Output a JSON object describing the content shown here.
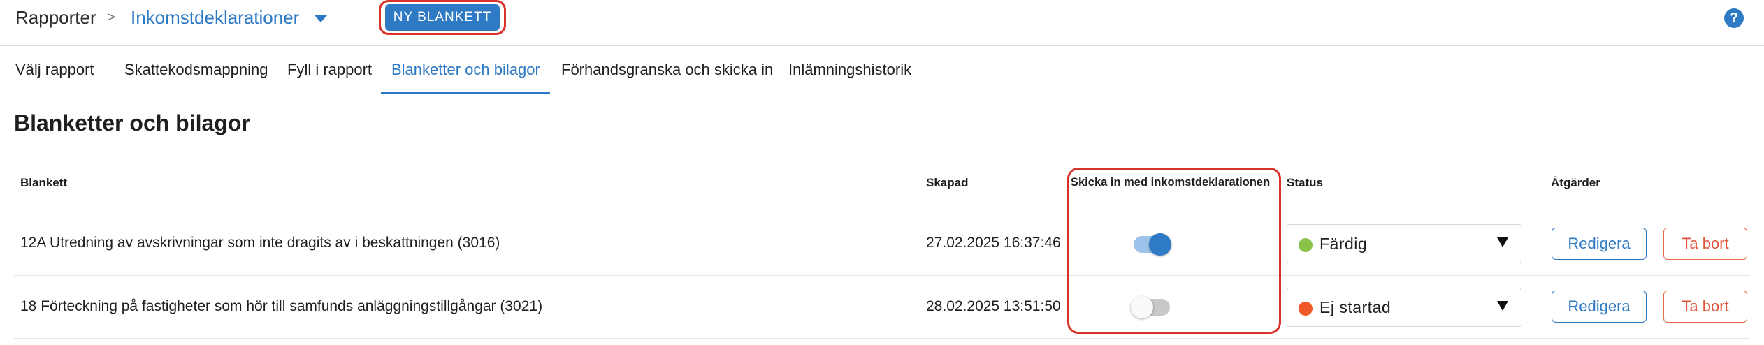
{
  "breadcrumb": {
    "root": "Rapporter",
    "separator": ">",
    "current": "Inkomstdeklarationer"
  },
  "header": {
    "new_button_label": "NY BLANKETT",
    "help_label": "?"
  },
  "tabs": [
    {
      "label": "Välj rapport",
      "active": false
    },
    {
      "label": "Skattekodsmappning",
      "active": false
    },
    {
      "label": "Fyll i rapport",
      "active": false
    },
    {
      "label": "Blanketter och bilagor",
      "active": true
    },
    {
      "label": "Förhandsgranska och skicka in",
      "active": false
    },
    {
      "label": "Inlämningshistorik",
      "active": false
    }
  ],
  "page_title": "Blanketter och bilagor",
  "table": {
    "columns": {
      "form": "Blankett",
      "created": "Skapad",
      "submit_with": "Skicka in med inkomstdeklarationen",
      "status": "Status",
      "actions": "Åtgärder"
    },
    "rows": [
      {
        "form": "12A Utredning av avskrivningar som inte dragits av i beskattningen (3016)",
        "created": "27.02.2025 16:37:46",
        "submit_with": true,
        "status": "Färdig",
        "status_color": "#8bc34a",
        "edit_label": "Redigera",
        "delete_label": "Ta bort"
      },
      {
        "form": "18 Förteckning på fastigheter som hör till samfunds anläggningstillgångar (3021)",
        "created": "28.02.2025 13:51:50",
        "submit_with": false,
        "status": "Ej startad",
        "status_color": "#f05a28",
        "edit_label": "Redigera",
        "delete_label": "Ta bort"
      }
    ]
  },
  "colors": {
    "accent": "#2f7ac4",
    "highlight": "#d9322b",
    "danger": "#e0553a"
  }
}
